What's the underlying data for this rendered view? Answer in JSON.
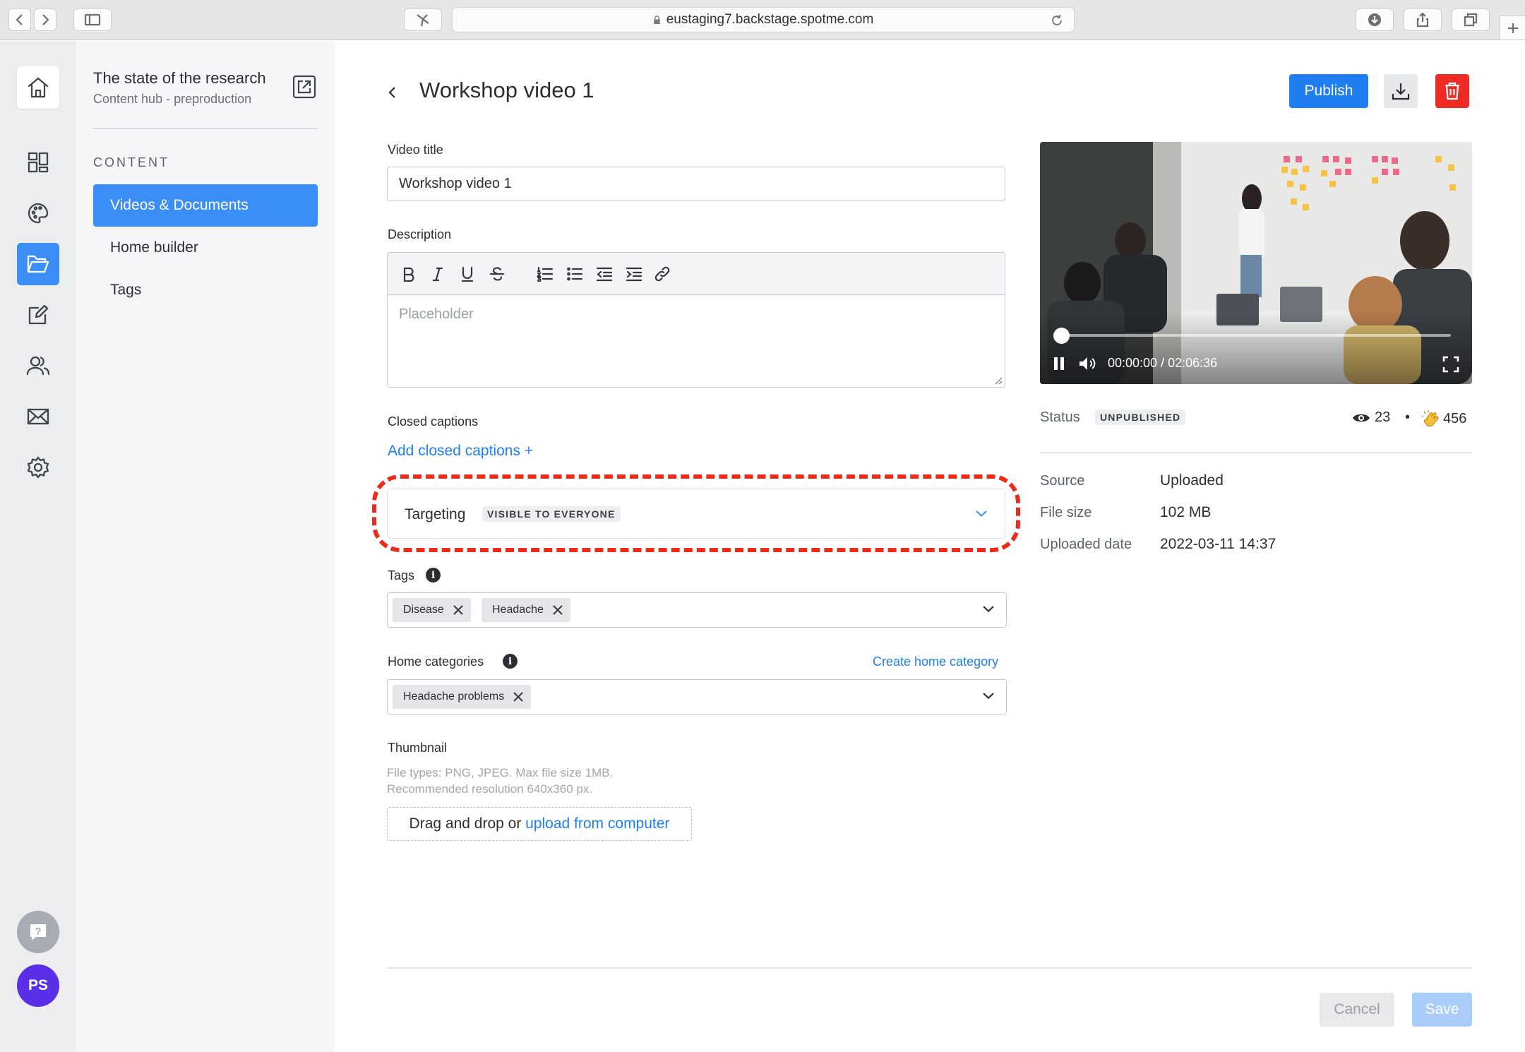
{
  "browser": {
    "url": "eustaging7.backstage.spotme.com"
  },
  "rail": {
    "items": [
      "home-icon",
      "dashboard-icon",
      "palette-icon",
      "folder-icon",
      "edit-icon",
      "people-icon",
      "mail-icon",
      "gear-icon"
    ],
    "active": "folder-icon",
    "avatar_initials": "PS"
  },
  "panel": {
    "title": "The state of the research",
    "subtitle": "Content hub - preproduction",
    "section_label": "CONTENT",
    "nav": [
      {
        "label": "Videos & Documents",
        "active": true
      },
      {
        "label": "Home builder",
        "active": false
      },
      {
        "label": "Tags",
        "active": false
      }
    ]
  },
  "header": {
    "title": "Workshop video 1",
    "publish_label": "Publish"
  },
  "form": {
    "video_title_label": "Video title",
    "video_title_value": "Workshop video 1",
    "description_label": "Description",
    "description_placeholder": "Placeholder",
    "closed_captions_label": "Closed captions",
    "add_captions_link": "Add closed captions +",
    "targeting_label": "Targeting",
    "targeting_badge": "VISIBLE TO EVERYONE",
    "tags_label": "Tags",
    "tags": [
      "Disease",
      "Headache"
    ],
    "home_categories_label": "Home categories",
    "create_home_category_link": "Create home category",
    "home_categories": [
      "Headache problems"
    ],
    "thumbnail_label": "Thumbnail",
    "thumbnail_hint_1": "File types: PNG, JPEG. Max file size 1MB.",
    "thumbnail_hint_2": "Recommended resolution 640x360 px.",
    "dropzone_text": "Drag and drop or",
    "dropzone_link": "upload from computer"
  },
  "video": {
    "time": "00:00:00 / 02:06:36",
    "progress": 0
  },
  "info": {
    "status_label": "Status",
    "status_badge": "UNPUBLISHED",
    "views": "23",
    "claps": "456",
    "separator": "•",
    "rows": [
      {
        "key": "Source",
        "value": "Uploaded"
      },
      {
        "key": "File size",
        "value": "102 MB"
      },
      {
        "key": "Uploaded date",
        "value": "2022-03-11 14:37"
      }
    ]
  },
  "footer": {
    "cancel_label": "Cancel",
    "save_label": "Save"
  },
  "colors": {
    "accent": "#1f7ff2",
    "danger": "#ee2b24",
    "highlight_ring": "#ee2b18",
    "avatar": "#5b2ee8"
  }
}
